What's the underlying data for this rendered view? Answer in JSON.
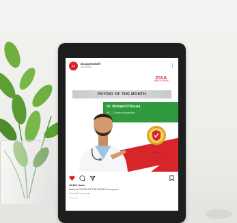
{
  "post": {
    "account_name": "zixaspetoshelf",
    "account_subtitle": "Sponsored",
    "avatar_text": "ZX",
    "more_label": "⋮"
  },
  "image": {
    "brand_logo": "ZIXA",
    "brand_tagline": "MEDICAL BRAND",
    "title": "PHYSIO OF THE MONTH",
    "doctor_name": "Dr. Richard D'Souza",
    "doctor_credentials": "BPT - 12 years of experience",
    "badge_caption": "ZIXA Seal"
  },
  "engagement": {
    "likes": "10,328 views",
    "caption_text": "Meet our PHYSIO OF THE MONTH",
    "caption_hashtag": "#zixaphysio",
    "comments": "View all 56 comments",
    "time": "1 day ago"
  },
  "icons": {
    "like": "heart-icon",
    "comment": "comment-icon",
    "share": "send-icon",
    "save": "bookmark-icon"
  },
  "colors": {
    "brand_red": "#d8242b",
    "accent_green": "#2f9a3e",
    "badge_gold": "#d9a520",
    "tablet_bezel": "#1e1e1e"
  }
}
